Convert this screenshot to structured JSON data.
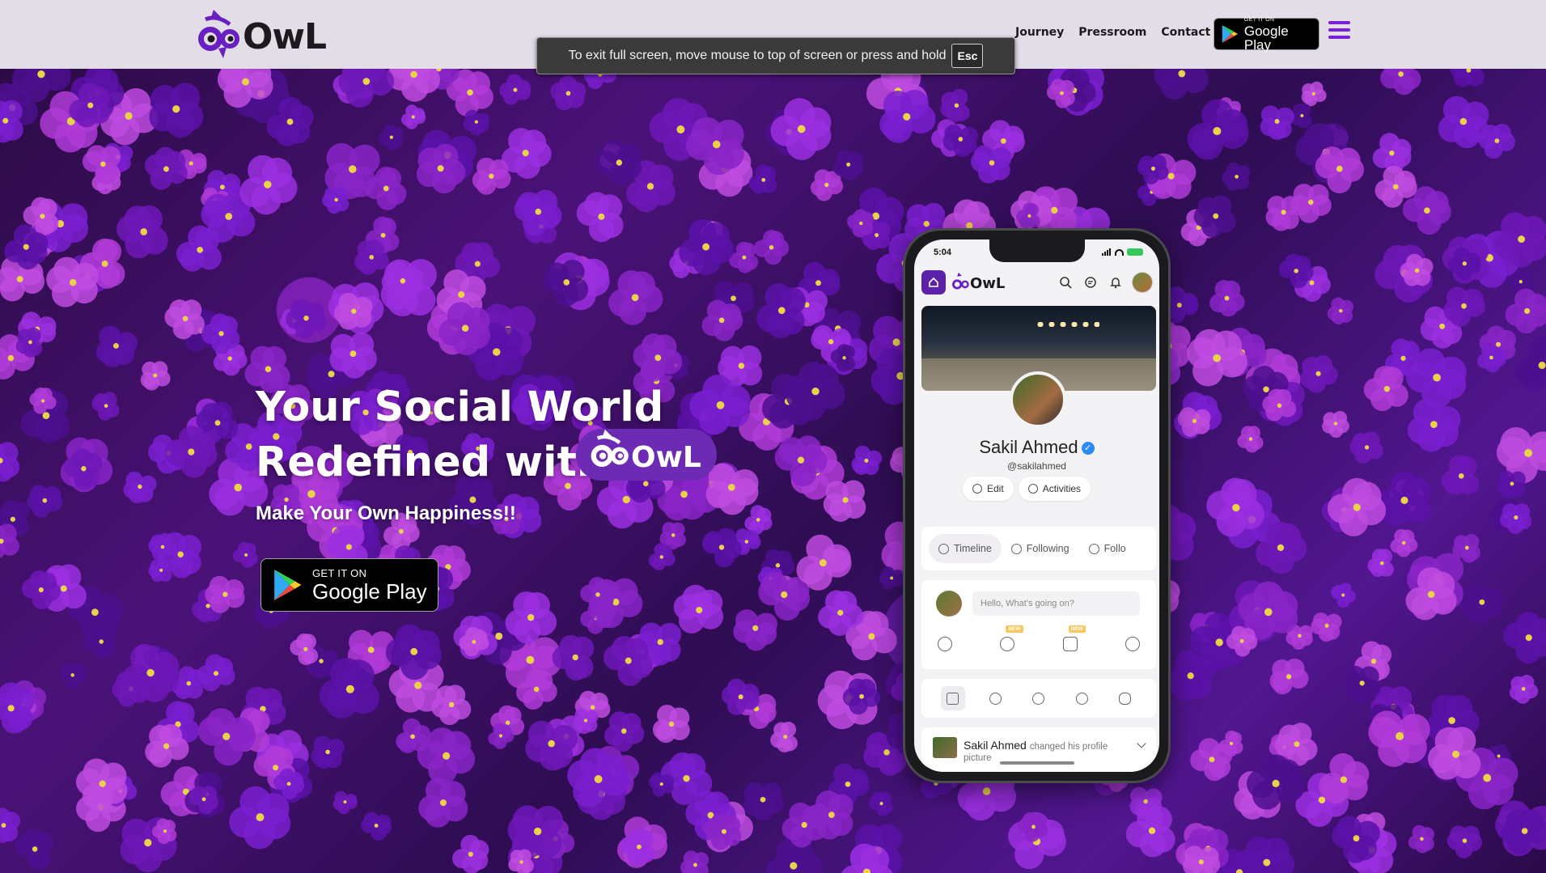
{
  "header": {
    "brand": "OwL",
    "nav": [
      "Journey",
      "Pressroom",
      "Contact"
    ],
    "play_badge": {
      "small": "GET IT ON",
      "big": "Google Play"
    }
  },
  "fullscreen_toast": {
    "message": "To exit full screen, move mouse to top of screen or press and hold",
    "key": "Esc"
  },
  "hero": {
    "headline_line1": "Your Social World",
    "headline_line2": "Redefined with",
    "pill_brand": "OwL",
    "tagline": "Make Your Own Happiness!!",
    "play_badge": {
      "small": "GET IT ON",
      "big": "Google Play"
    }
  },
  "phone": {
    "time": "5:04",
    "app_brand": "OwL",
    "profile": {
      "name": "Sakil Ahmed",
      "handle": "@sakilahmed",
      "actions": [
        "Edit",
        "Activities"
      ]
    },
    "tabs": [
      "Timeline",
      "Following",
      "Follo"
    ],
    "compose_placeholder": "Hello, What's going on?",
    "new_badge": "NEW",
    "feed": {
      "author": "Sakil Ahmed",
      "action": "changed his profile",
      "action_cont": "picture"
    }
  },
  "colors": {
    "brand_purple": "#7b1fd6",
    "header_bg": "#e2dde6",
    "pill_bg": "#6d2bb3"
  }
}
